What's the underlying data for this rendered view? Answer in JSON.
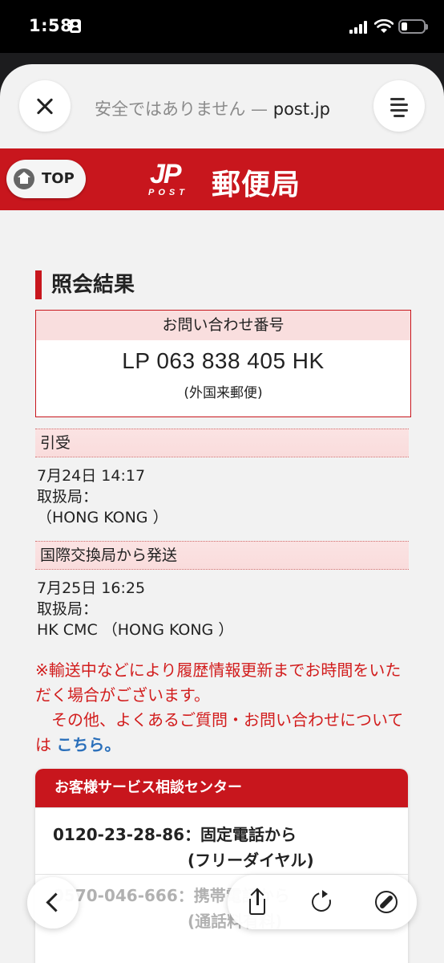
{
  "status_bar": {
    "time": "1:58"
  },
  "browser": {
    "address_warning": "安全ではありません — ",
    "address_domain": "post.jp"
  },
  "header": {
    "top_button_label": "TOP",
    "logo_mark": "JP",
    "logo_sub": "POST",
    "brand_name": "郵便局"
  },
  "result": {
    "section_title": "照会結果",
    "inquiry_label": "お問い合わせ番号",
    "tracking_number": "LP 063 838 405 HK",
    "item_type": "(外国来郵便)"
  },
  "events": [
    {
      "status": "引受",
      "datetime": "7月24日 14:17",
      "office_label": "取扱局：",
      "office": "（HONG KONG ）"
    },
    {
      "status": "国際交換局から発送",
      "datetime": "7月25日 16:25",
      "office_label": "取扱局：",
      "office": "HK CMC （HONG KONG ）"
    }
  ],
  "notice": {
    "line1": "※輸送中などにより履歴情報更新までお時間をいただく場合がございます。",
    "line2": "　その他、よくあるご質問・お問い合わせについては ",
    "link": "こちら。"
  },
  "support": {
    "title": "お客様サービス相談センター",
    "phone1": "0120-23-28-86：固定電話から",
    "phone1_note": "(フリーダイヤル)",
    "phone2": "0570-046-666：携帯電話から",
    "phone2_note": "(通話料有料)"
  },
  "colors": {
    "brand_red": "#c8161d",
    "link_blue": "#2a6fba",
    "notice_red": "#d21d1d"
  },
  "icons": [
    "close-icon",
    "reader-icon",
    "home-icon",
    "back-icon",
    "share-icon",
    "reload-icon",
    "compass-icon"
  ]
}
